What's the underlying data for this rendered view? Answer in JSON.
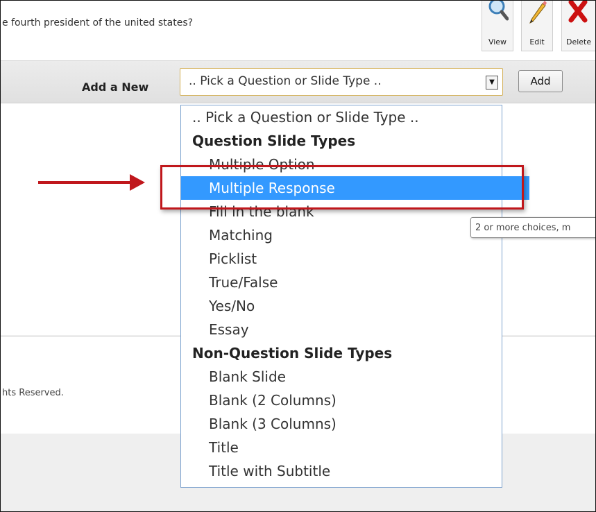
{
  "question": {
    "text": "e fourth president of the united states?",
    "buttons": [
      {
        "label": "View",
        "icon": "magnifier-icon"
      },
      {
        "label": "Edit",
        "icon": "pencil-icon"
      },
      {
        "label": "Delete",
        "icon": "delete-x-icon"
      }
    ]
  },
  "add_bar": {
    "label": "Add a New",
    "select_value": ".. Pick a Question or Slide Type ..",
    "add_button": "Add"
  },
  "dropdown": {
    "placeholder": ".. Pick a Question or Slide Type ..",
    "groups": [
      {
        "label": "Question Slide Types",
        "options": [
          "Multiple Option",
          "Multiple Response",
          "Fill in the blank",
          "Matching",
          "Picklist",
          "True/False",
          "Yes/No",
          "Essay"
        ]
      },
      {
        "label": "Non-Question Slide Types",
        "options": [
          "Blank Slide",
          "Blank (2 Columns)",
          "Blank (3 Columns)",
          "Title",
          "Title with Subtitle"
        ]
      }
    ],
    "selected": "Multiple Response"
  },
  "tooltip": "2 or more choices, m",
  "footer": {
    "copyright": "hts Reserved."
  },
  "colors": {
    "selection": "#3399ff",
    "annotation": "#c0171c",
    "delete_icon": "#cc1111"
  }
}
